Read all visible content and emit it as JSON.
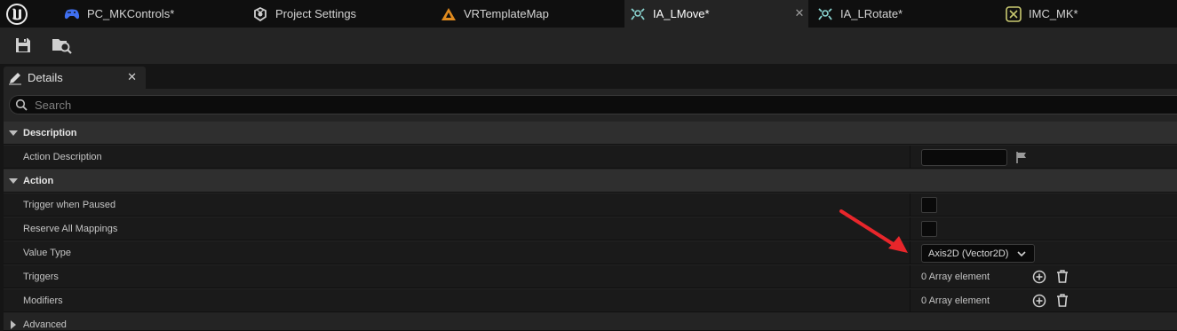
{
  "tabs": [
    {
      "label": "PC_MKControls*",
      "icon": "gamepad-icon"
    },
    {
      "label": "Project Settings",
      "icon": "settings-icon"
    },
    {
      "label": "VRTemplateMap",
      "icon": "level-map-icon"
    },
    {
      "label": "IA_LMove*",
      "icon": "input-action-icon"
    },
    {
      "label": "IA_LRotate*",
      "icon": "input-action-icon"
    },
    {
      "label": "IMC_MK*",
      "icon": "input-mapping-context-icon"
    }
  ],
  "active_tab": "IA_LMove*",
  "toolbar": {
    "save": "save-icon",
    "browse": "browse-to-asset-icon"
  },
  "panel": {
    "title": "Details",
    "search_placeholder": "Search"
  },
  "categories": {
    "description": "Description",
    "action": "Action",
    "advanced": "Advanced"
  },
  "properties": {
    "action_description": {
      "label": "Action Description",
      "value": ""
    },
    "trigger_when_paused": {
      "label": "Trigger when Paused",
      "checked": false
    },
    "reserve_all_mappings": {
      "label": "Reserve All Mappings",
      "checked": false
    },
    "value_type": {
      "label": "Value Type",
      "value": "Axis2D (Vector2D)"
    },
    "triggers": {
      "label": "Triggers",
      "value": "0 Array element"
    },
    "modifiers": {
      "label": "Modifiers",
      "value": "0 Array element"
    }
  },
  "colors": {
    "accent_annotation": "#e8262b",
    "background": "#242424",
    "category_row": "#2f2f2f"
  }
}
